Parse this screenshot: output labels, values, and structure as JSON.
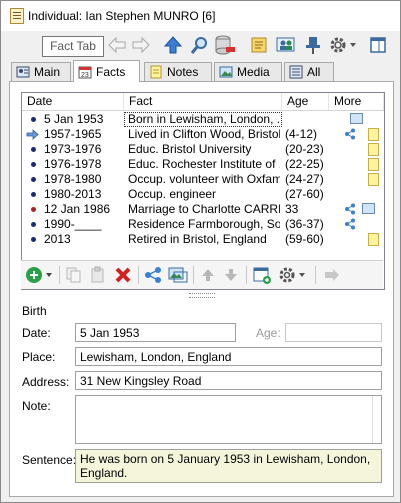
{
  "window": {
    "title": "Individual: Ian Stephen MUNRO [6]"
  },
  "tooltip": {
    "text": "Fact Tab"
  },
  "toolbar": {
    "icons": [
      "back-arrow-icon",
      "forward-arrow-icon",
      "up-arrow-icon",
      "magnifier-icon",
      "database-delete-icon",
      "scroll-icon",
      "people-icon",
      "pin-icon",
      "gear-menu-icon",
      "dock-window-icon"
    ]
  },
  "tabs": [
    {
      "label": "Main"
    },
    {
      "label": "Facts",
      "active": true
    },
    {
      "label": "Notes"
    },
    {
      "label": "Media"
    },
    {
      "label": "All"
    }
  ],
  "grid": {
    "columns": [
      "Date",
      "Fact",
      "Age",
      "More"
    ],
    "rows": [
      {
        "date": "5 Jan 1953",
        "fact": "Born in Lewisham, London, ...",
        "age": "",
        "marker": "dot",
        "more": [
          "picture"
        ]
      },
      {
        "date": "1957-1965",
        "fact": "Lived in Clifton Wood, Bristol...",
        "age": "(4-12)",
        "marker": "arrow",
        "more": [
          "share",
          "note"
        ]
      },
      {
        "date": "1973-1976",
        "fact": "Educ. Bristol University",
        "age": "(20-23)",
        "marker": "dot",
        "more": [
          "note"
        ]
      },
      {
        "date": "1976-1978",
        "fact": "Educ. Rochester Institute of ...",
        "age": "(22-25)",
        "marker": "dot",
        "more": [
          "note"
        ]
      },
      {
        "date": "1978-1980",
        "fact": "Occup. volunteer with Oxfam",
        "age": "(24-27)",
        "marker": "dot",
        "more": [
          "note"
        ]
      },
      {
        "date": "1980-2013",
        "fact": "Occup. engineer",
        "age": "(27-60)",
        "marker": "dot",
        "more": []
      },
      {
        "date": "12 Jan 1986",
        "fact": "Marriage to Charlotte CARRI...",
        "age": "33",
        "marker": "red-dot",
        "more": [
          "share",
          "picture"
        ]
      },
      {
        "date": "1990-____",
        "fact": "Residence Farmborough, So...",
        "age": "(36-37)",
        "marker": "dot",
        "more": [
          "share"
        ]
      },
      {
        "date": "2013",
        "fact": "Retired in Bristol, England",
        "age": "(59-60)",
        "marker": "dot",
        "more": [
          "note"
        ]
      }
    ]
  },
  "detail": {
    "section": "Birth",
    "date_label": "Date:",
    "date_value": "5 Jan 1953",
    "age_label": "Age:",
    "age_value": "",
    "place_label": "Place:",
    "place_value": "Lewisham, London, England",
    "address_label": "Address:",
    "address_value": "31 New Kingsley Road",
    "note_label": "Note:",
    "note_value": "",
    "sentence_label": "Sentence:",
    "sentence_line1": "He was born on 5 January 1953 in Lewisham, London,",
    "sentence_line2": "England."
  },
  "colors": {
    "accent": "#1a2a7a",
    "selection_border": "#333333",
    "sentence_bg": "#f5f5dc"
  }
}
